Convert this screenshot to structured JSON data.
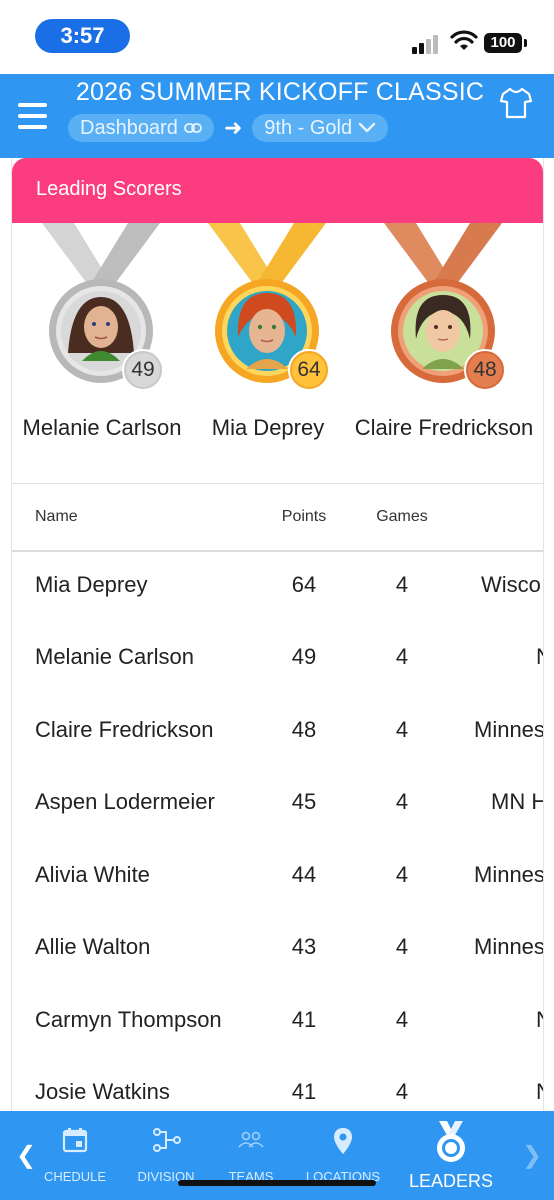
{
  "status_bar": {
    "time": "3:57",
    "battery": "100"
  },
  "header": {
    "title": "2026 SUMMER KICKOFF CLASSIC",
    "breadcrumb_dashboard": "Dashboard",
    "breadcrumb_division": "9th - Gold"
  },
  "card": {
    "title": "Leading Scorers",
    "podium": [
      {
        "name": "Melanie Carlson",
        "points": "49",
        "medal": "silver"
      },
      {
        "name": "Mia Deprey",
        "points": "64",
        "medal": "gold"
      },
      {
        "name": "Claire Fredrickson",
        "points": "48",
        "medal": "bronze"
      }
    ]
  },
  "table": {
    "columns": [
      "Name",
      "Points",
      "Games"
    ],
    "rows": [
      {
        "name": "Mia Deprey",
        "points": "64",
        "games": "4",
        "team": "Wisco"
      },
      {
        "name": "Melanie Carlson",
        "points": "49",
        "games": "4",
        "team": "N"
      },
      {
        "name": "Claire Fredrickson",
        "points": "48",
        "games": "4",
        "team": "Minnes"
      },
      {
        "name": "Aspen Lodermeier",
        "points": "45",
        "games": "4",
        "team": "MN H"
      },
      {
        "name": "Alivia White",
        "points": "44",
        "games": "4",
        "team": "Minnes"
      },
      {
        "name": "Allie Walton",
        "points": "43",
        "games": "4",
        "team": "Minnes"
      },
      {
        "name": "Carmyn Thompson",
        "points": "41",
        "games": "4",
        "team": "N"
      },
      {
        "name": "Josie Watkins",
        "points": "41",
        "games": "4",
        "team": "N"
      }
    ]
  },
  "bottom_nav": {
    "items": [
      {
        "label": "CHEDULE",
        "icon": "calendar-icon"
      },
      {
        "label": "DIVISION",
        "icon": "bracket-icon"
      },
      {
        "label": "TEAMS",
        "icon": "people-icon"
      },
      {
        "label": "LOCATIONS",
        "icon": "map-pin-icon"
      },
      {
        "label": "LEADERS",
        "icon": "medal-icon"
      }
    ]
  },
  "colors": {
    "primary": "#2f96f2",
    "card_header": "#fb3d7f",
    "gold": "#f5a623",
    "silver": "#b8b8b8",
    "bronze": "#d66a3b"
  }
}
